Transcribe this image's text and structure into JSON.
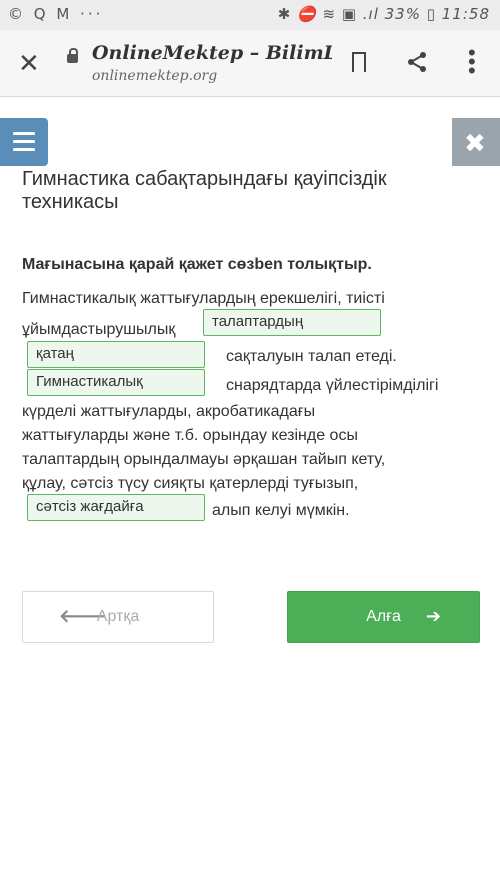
{
  "status_bar": {
    "left_icons": "© Q M ···",
    "right_status": "✱ ⛔ ≋ ▣ .ıl 33% ▯ 11:58"
  },
  "browser": {
    "site_title": "OnlineMektep – BilimL...",
    "domain": "onlinemektep.org"
  },
  "page": {
    "title": "Гимнастика сабақтарындағы қауіпсіздік техникасы",
    "instruction": "Мағынасына қарай қажет сөзben толықтыр."
  },
  "exercise": {
    "line1": "Гимнастикалық жаттығулардың ерекшелігі, тиісті",
    "line2_prefix": "ұйымдастырушылық",
    "blank1": "талаптардың",
    "blank2": "қатаң",
    "line3_suffix": "сақталуын талап етеді.",
    "blank3": "Гимнастикалық",
    "line4_suffix": "снарядтарда үйлестірімділігі",
    "line5": "күрделі жаттығуларды, акробатикадағы",
    "line6": "жаттығуларды және т.б. орындау кезінде осы",
    "line7": "талаптардың орындалмауы әрқашан тайып кету,",
    "line8": "құлау, сәтсіз түсу сияқты қатерлерді туғызып,",
    "blank4": "сәтсіз жағдайға",
    "line9_suffix": "алып келуі мүмкін."
  },
  "nav": {
    "back_label": "Артқа",
    "next_label": "Алға",
    "back_arrow": "🡐",
    "next_arrow": "➔"
  },
  "icons": {
    "close": "✕",
    "menu_dots": "⋮",
    "hamburger": "☰",
    "sidebar_close": "✖"
  },
  "colors": {
    "accent_blue": "#5a8db7",
    "success_green": "#4cae57",
    "blank_border": "#5cb85c"
  }
}
